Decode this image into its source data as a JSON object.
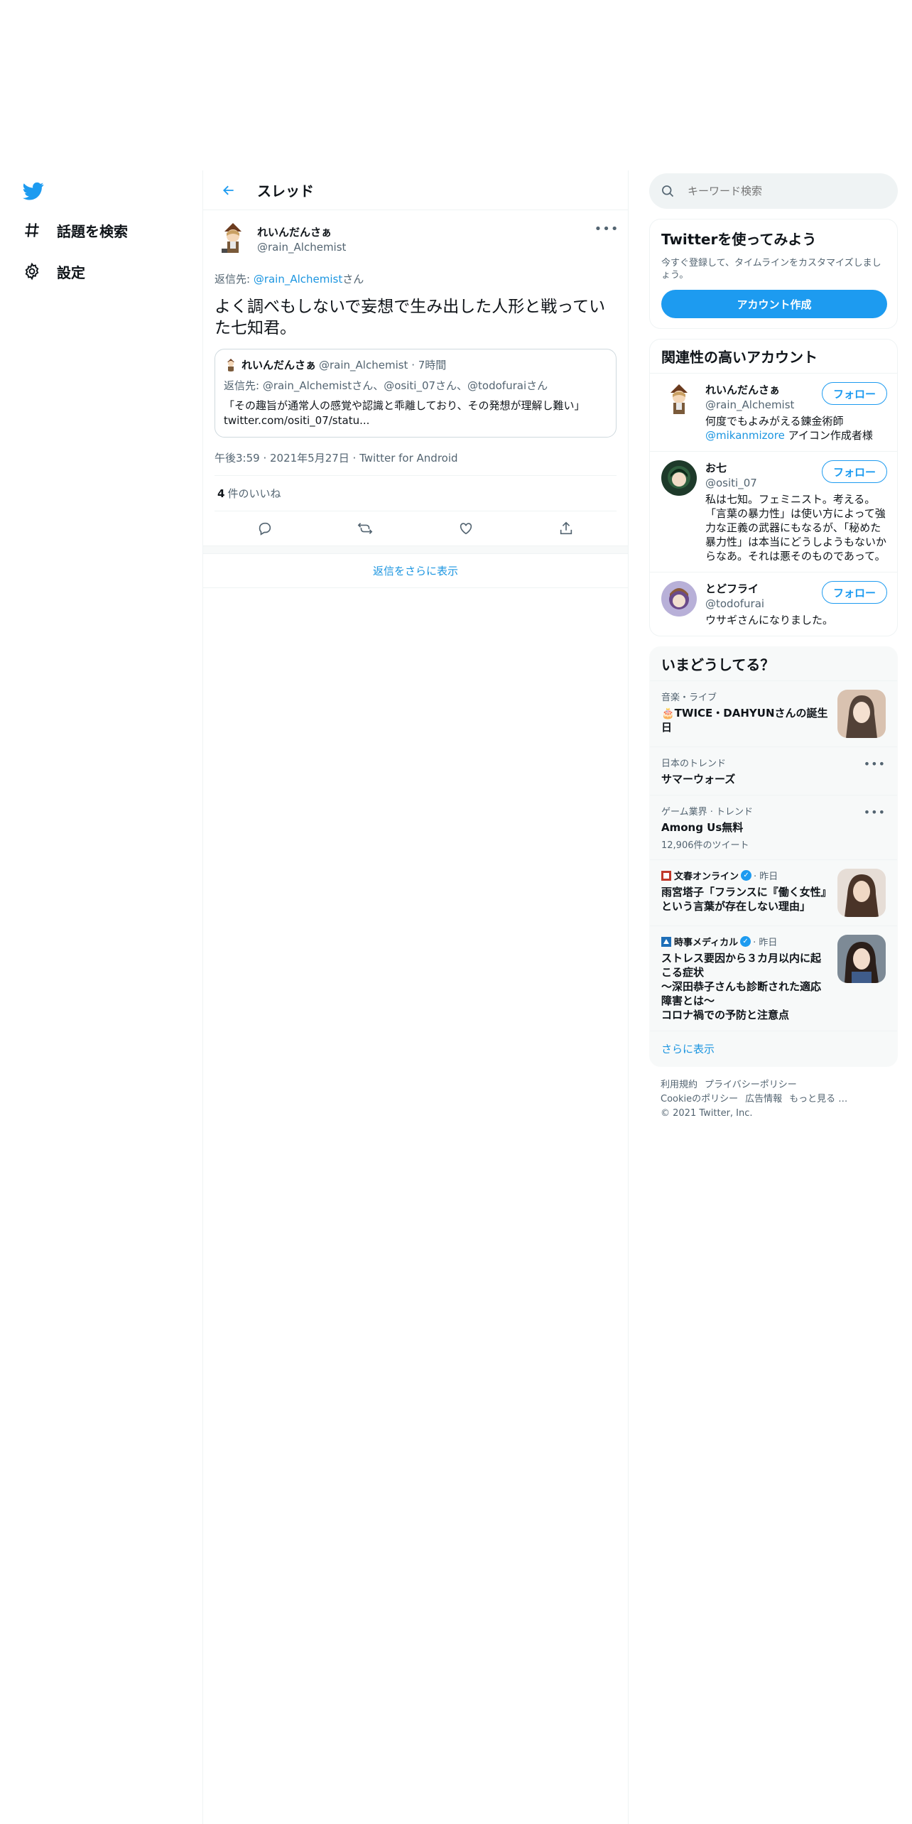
{
  "nav": {
    "logo": "twitter-bird",
    "items": [
      {
        "label": "話題を検索",
        "icon": "hashtag"
      },
      {
        "label": "設定",
        "icon": "gear"
      }
    ]
  },
  "thread": {
    "title": "スレッド",
    "tweet": {
      "name": "れいんだんさぁ",
      "handle": "@rain_Alchemist",
      "reply_prefix": "返信先: ",
      "reply_link": "@rain_Alchemist",
      "reply_suffix": "さん",
      "text": "よく調べもしないで妄想で生み出した人形と戦っていた七知君。",
      "quote": {
        "name": "れいんだんさぁ",
        "meta": "@rain_Alchemist · 7時間",
        "reply": "返信先: @rain_Alchemistさん、@ositi_07さん、@todofuraiさん",
        "text": "「その趣旨が通常人の感覚や認識と乖離しており、その発想が理解し難い」twitter.com/ositi_07/statu..."
      },
      "meta": "午後3:59 · 2021年5月27日 · Twitter for Android",
      "likes_count": "4",
      "likes_label": "件のいいね"
    },
    "show_more_replies": "返信をさらに表示"
  },
  "sidebar": {
    "search_placeholder": "キーワード検索",
    "signup": {
      "title": "Twitterを使ってみよう",
      "desc": "今すぐ登録して、タイムラインをカスタマイズしましょう。",
      "button": "アカウント作成"
    },
    "relevant": {
      "title": "関連性の高いアカウント",
      "follow_label": "フォロー",
      "accounts": [
        {
          "name": "れいんだんさぁ",
          "handle": "@rain_Alchemist",
          "bio_pre": "何度でもよみがえる錬金術師",
          "bio_link": "@mikanmizore",
          "bio_post": " アイコン作成者様"
        },
        {
          "name": "お七",
          "handle": "@ositi_07",
          "bio_pre": "私は七知。フェミニスト。考える。「言葉の暴力性」は使い方によって強力な正義の武器にもなるが、「秘めた暴力性」は本当にどうしようもないからなあ。それは悪そのものであって。",
          "bio_link": "",
          "bio_post": ""
        },
        {
          "name": "とどフライ",
          "handle": "@todofurai",
          "bio_pre": "ウサギさんになりました。",
          "bio_link": "",
          "bio_post": ""
        }
      ]
    },
    "trends": {
      "title": "いまどうしてる？",
      "items": [
        {
          "category": "音楽・ライブ",
          "title": "🎂TWICE・DAHYUNさんの誕生日"
        },
        {
          "category": "日本のトレンド",
          "title": "サマーウォーズ"
        },
        {
          "category": "ゲーム業界 · トレンド",
          "title": "Among Us無料",
          "count": "12,906件のツイート"
        },
        {
          "source": "文春オンライン",
          "time": "· 昨日",
          "title": "雨宮塔子「フランスに『働く女性』という言葉が存在しない理由」"
        },
        {
          "source": "時事メディカル",
          "time": "· 昨日",
          "title": "ストレス要因から３カ月以内に起こる症状\n～深田恭子さんも診断された適応障害とは～\nコロナ禍での予防と注意点"
        }
      ],
      "show_more": "さらに表示"
    },
    "footer": {
      "links": [
        "利用規約",
        "プライバシーポリシー",
        "Cookieのポリシー",
        "広告情報",
        "もっと見る …"
      ],
      "copyright": "© 2021 Twitter, Inc."
    }
  },
  "colors": {
    "accent": "#1d9bf0",
    "link": "#1b95e0",
    "text": "#0f1419",
    "muted": "#536471"
  }
}
